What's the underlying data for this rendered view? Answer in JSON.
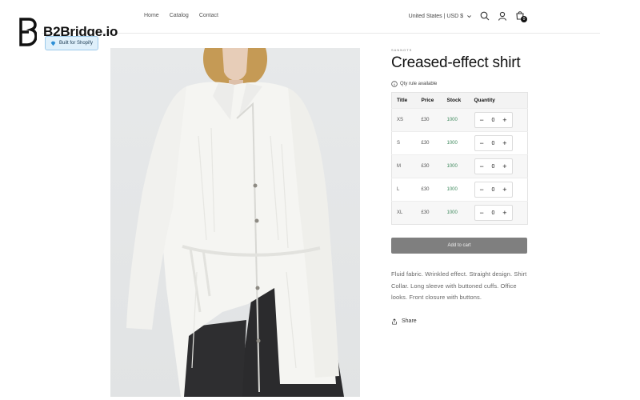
{
  "brand": {
    "name": "B2Bridge.io",
    "badge": "Built for Shopify"
  },
  "nav": {
    "items": [
      "Home",
      "Catalog",
      "Contact"
    ]
  },
  "header": {
    "country": "United States | USD $",
    "cart_count": "0"
  },
  "product": {
    "vendor": "SANNOTS",
    "title": "Creased-effect shirt",
    "qty_rule": "Qty rule available",
    "table": {
      "headers": [
        "Title",
        "Price",
        "Stock",
        "Quantity"
      ],
      "rows": [
        {
          "title": "XS",
          "price": "£30",
          "stock": "1000",
          "qty": "0"
        },
        {
          "title": "S",
          "price": "£30",
          "stock": "1000",
          "qty": "0"
        },
        {
          "title": "M",
          "price": "£30",
          "stock": "1000",
          "qty": "0"
        },
        {
          "title": "L",
          "price": "£30",
          "stock": "1000",
          "qty": "0"
        },
        {
          "title": "XL",
          "price": "£30",
          "stock": "1000",
          "qty": "0"
        }
      ]
    },
    "add_to_cart": "Add to cart",
    "description": "Fluid fabric. Wrinkled effect. Straight design. Shirt Collar. Long sleeve with buttoned cuffs. Office looks. Front closure with buttons.",
    "share": "Share"
  },
  "stepper": {
    "minus": "−",
    "plus": "+"
  },
  "colors": {
    "stock_green": "#3f8a5e",
    "button_gray": "#7f7f7f",
    "badge_bg": "#dff0fb"
  }
}
